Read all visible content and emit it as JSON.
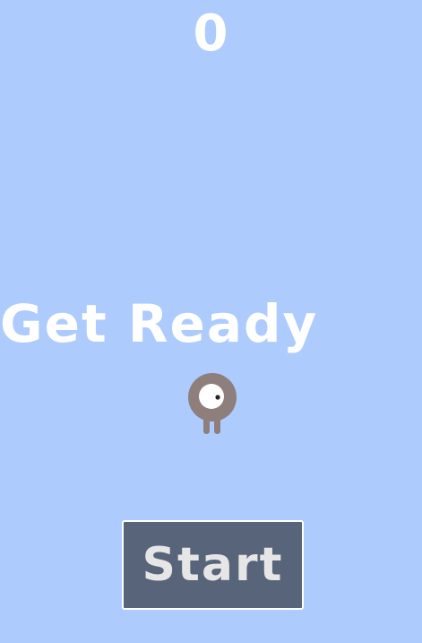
{
  "colors": {
    "background": "#adcbfd",
    "text": "#ffffff",
    "character_body": "#8e7f7d",
    "character_eye": "#ffffff",
    "character_pupil": "#222222",
    "button_fill": "#57647a",
    "button_label": "#e6e6e6"
  },
  "hud": {
    "score": "0"
  },
  "overlay": {
    "message": "Get Ready"
  },
  "character": {
    "icon": "one-eyed-ghost-icon"
  },
  "start_button": {
    "label": "Start"
  }
}
